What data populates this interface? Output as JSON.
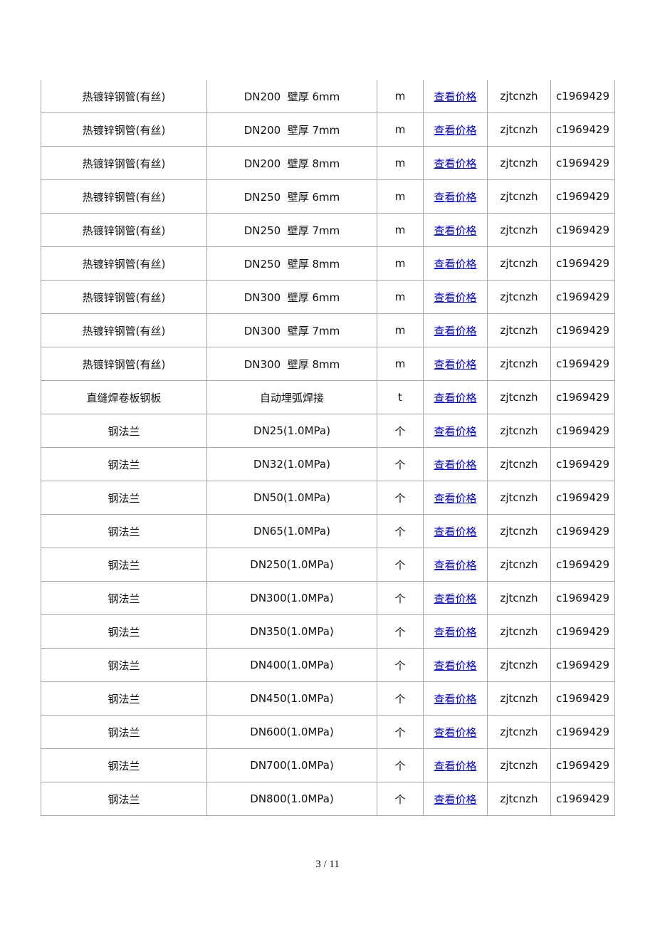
{
  "rows": [
    [
      "热镀锌钢管(有丝)",
      "DN200  壁厚 6mm",
      "m",
      "查看价格",
      "zjtcnzh",
      "c1969429"
    ],
    [
      "热镀锌钢管(有丝)",
      "DN200  壁厚 7mm",
      "m",
      "查看价格",
      "zjtcnzh",
      "c1969429"
    ],
    [
      "热镀锌钢管(有丝)",
      "DN200  壁厚 8mm",
      "m",
      "查看价格",
      "zjtcnzh",
      "c1969429"
    ],
    [
      "热镀锌钢管(有丝)",
      "DN250  壁厚 6mm",
      "m",
      "查看价格",
      "zjtcnzh",
      "c1969429"
    ],
    [
      "热镀锌钢管(有丝)",
      "DN250  壁厚 7mm",
      "m",
      "查看价格",
      "zjtcnzh",
      "c1969429"
    ],
    [
      "热镀锌钢管(有丝)",
      "DN250  壁厚 8mm",
      "m",
      "查看价格",
      "zjtcnzh",
      "c1969429"
    ],
    [
      "热镀锌钢管(有丝)",
      "DN300  壁厚 6mm",
      "m",
      "查看价格",
      "zjtcnzh",
      "c1969429"
    ],
    [
      "热镀锌钢管(有丝)",
      "DN300  壁厚 7mm",
      "m",
      "查看价格",
      "zjtcnzh",
      "c1969429"
    ],
    [
      "热镀锌钢管(有丝)",
      "DN300  壁厚 8mm",
      "m",
      "查看价格",
      "zjtcnzh",
      "c1969429"
    ],
    [
      "直缝焊卷板钢板",
      "自动埋弧焊接",
      "t",
      "查看价格",
      "zjtcnzh",
      "c1969429"
    ],
    [
      "钢法兰",
      "DN25(1.0MPa)",
      "个",
      "查看价格",
      "zjtcnzh",
      "c1969429"
    ],
    [
      "钢法兰",
      "DN32(1.0MPa)",
      "个",
      "查看价格",
      "zjtcnzh",
      "c1969429"
    ],
    [
      "钢法兰",
      "DN50(1.0MPa)",
      "个",
      "查看价格",
      "zjtcnzh",
      "c1969429"
    ],
    [
      "钢法兰",
      "DN65(1.0MPa)",
      "个",
      "查看价格",
      "zjtcnzh",
      "c1969429"
    ],
    [
      "钢法兰",
      "DN250(1.0MPa)",
      "个",
      "查看价格",
      "zjtcnzh",
      "c1969429"
    ],
    [
      "钢法兰",
      "DN300(1.0MPa)",
      "个",
      "查看价格",
      "zjtcnzh",
      "c1969429"
    ],
    [
      "钢法兰",
      "DN350(1.0MPa)",
      "个",
      "查看价格",
      "zjtcnzh",
      "c1969429"
    ],
    [
      "钢法兰",
      "DN400(1.0MPa)",
      "个",
      "查看价格",
      "zjtcnzh",
      "c1969429"
    ],
    [
      "钢法兰",
      "DN450(1.0MPa)",
      "个",
      "查看价格",
      "zjtcnzh",
      "c1969429"
    ],
    [
      "钢法兰",
      "DN600(1.0MPa)",
      "个",
      "查看价格",
      "zjtcnzh",
      "c1969429"
    ],
    [
      "钢法兰",
      "DN700(1.0MPa)",
      "个",
      "查看价格",
      "zjtcnzh",
      "c1969429"
    ],
    [
      "钢法兰",
      "DN800(1.0MPa)",
      "个",
      "查看价格",
      "zjtcnzh",
      "c1969429"
    ]
  ],
  "page_number": "3  / 11",
  "colors": {
    "link": "#0000ee",
    "border": "#a8a8a8"
  }
}
